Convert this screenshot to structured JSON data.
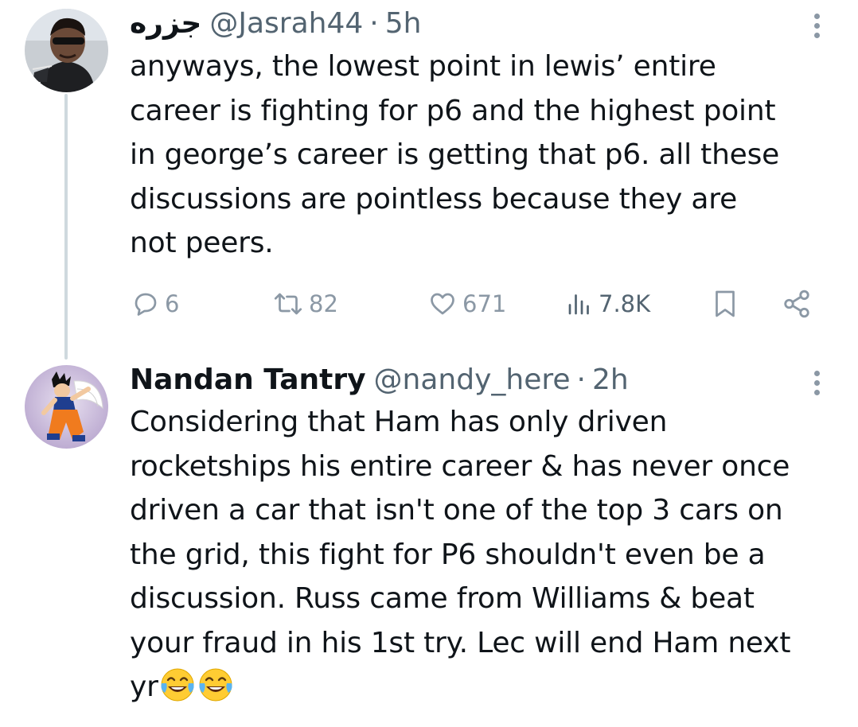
{
  "tweets": [
    {
      "display_name": "جزره",
      "handle": "@Jasrah44",
      "separator": "·",
      "time": "5h",
      "text": "anyways, the lowest point in lewis’ entire\ncareer is fighting for p6 and the highest point\nin george’s career is getting that p6. all these\ndiscussions are pointless because they are\nnot peers.",
      "stats": {
        "replies": "6",
        "retweets": "82",
        "likes": "671",
        "views": "7.8K"
      },
      "icons": [
        "reply-icon",
        "retweet-icon",
        "like-icon",
        "views-icon",
        "bookmark-icon",
        "share-icon",
        "more-icon"
      ]
    },
    {
      "display_name": "Nandan Tantry",
      "handle": "@nandy_here",
      "separator": "·",
      "time": "2h",
      "text": "Considering that Ham has only driven\nrocketships his entire career & has never once\ndriven a car that isn't one of the top 3 cars on\nthe grid, this fight for P6 shouldn't even be a\ndiscussion. Russ came from Williams & beat\nyour fraud in his 1st try. Lec will end Ham next\nyr",
      "trailing_emojis": [
        "😂",
        "😂"
      ],
      "icons": [
        "more-icon"
      ]
    }
  ],
  "colors": {
    "text": "#0f1419",
    "secondary": "#536471",
    "icon": "#8b98a5",
    "thread_line": "#cfd9de"
  }
}
